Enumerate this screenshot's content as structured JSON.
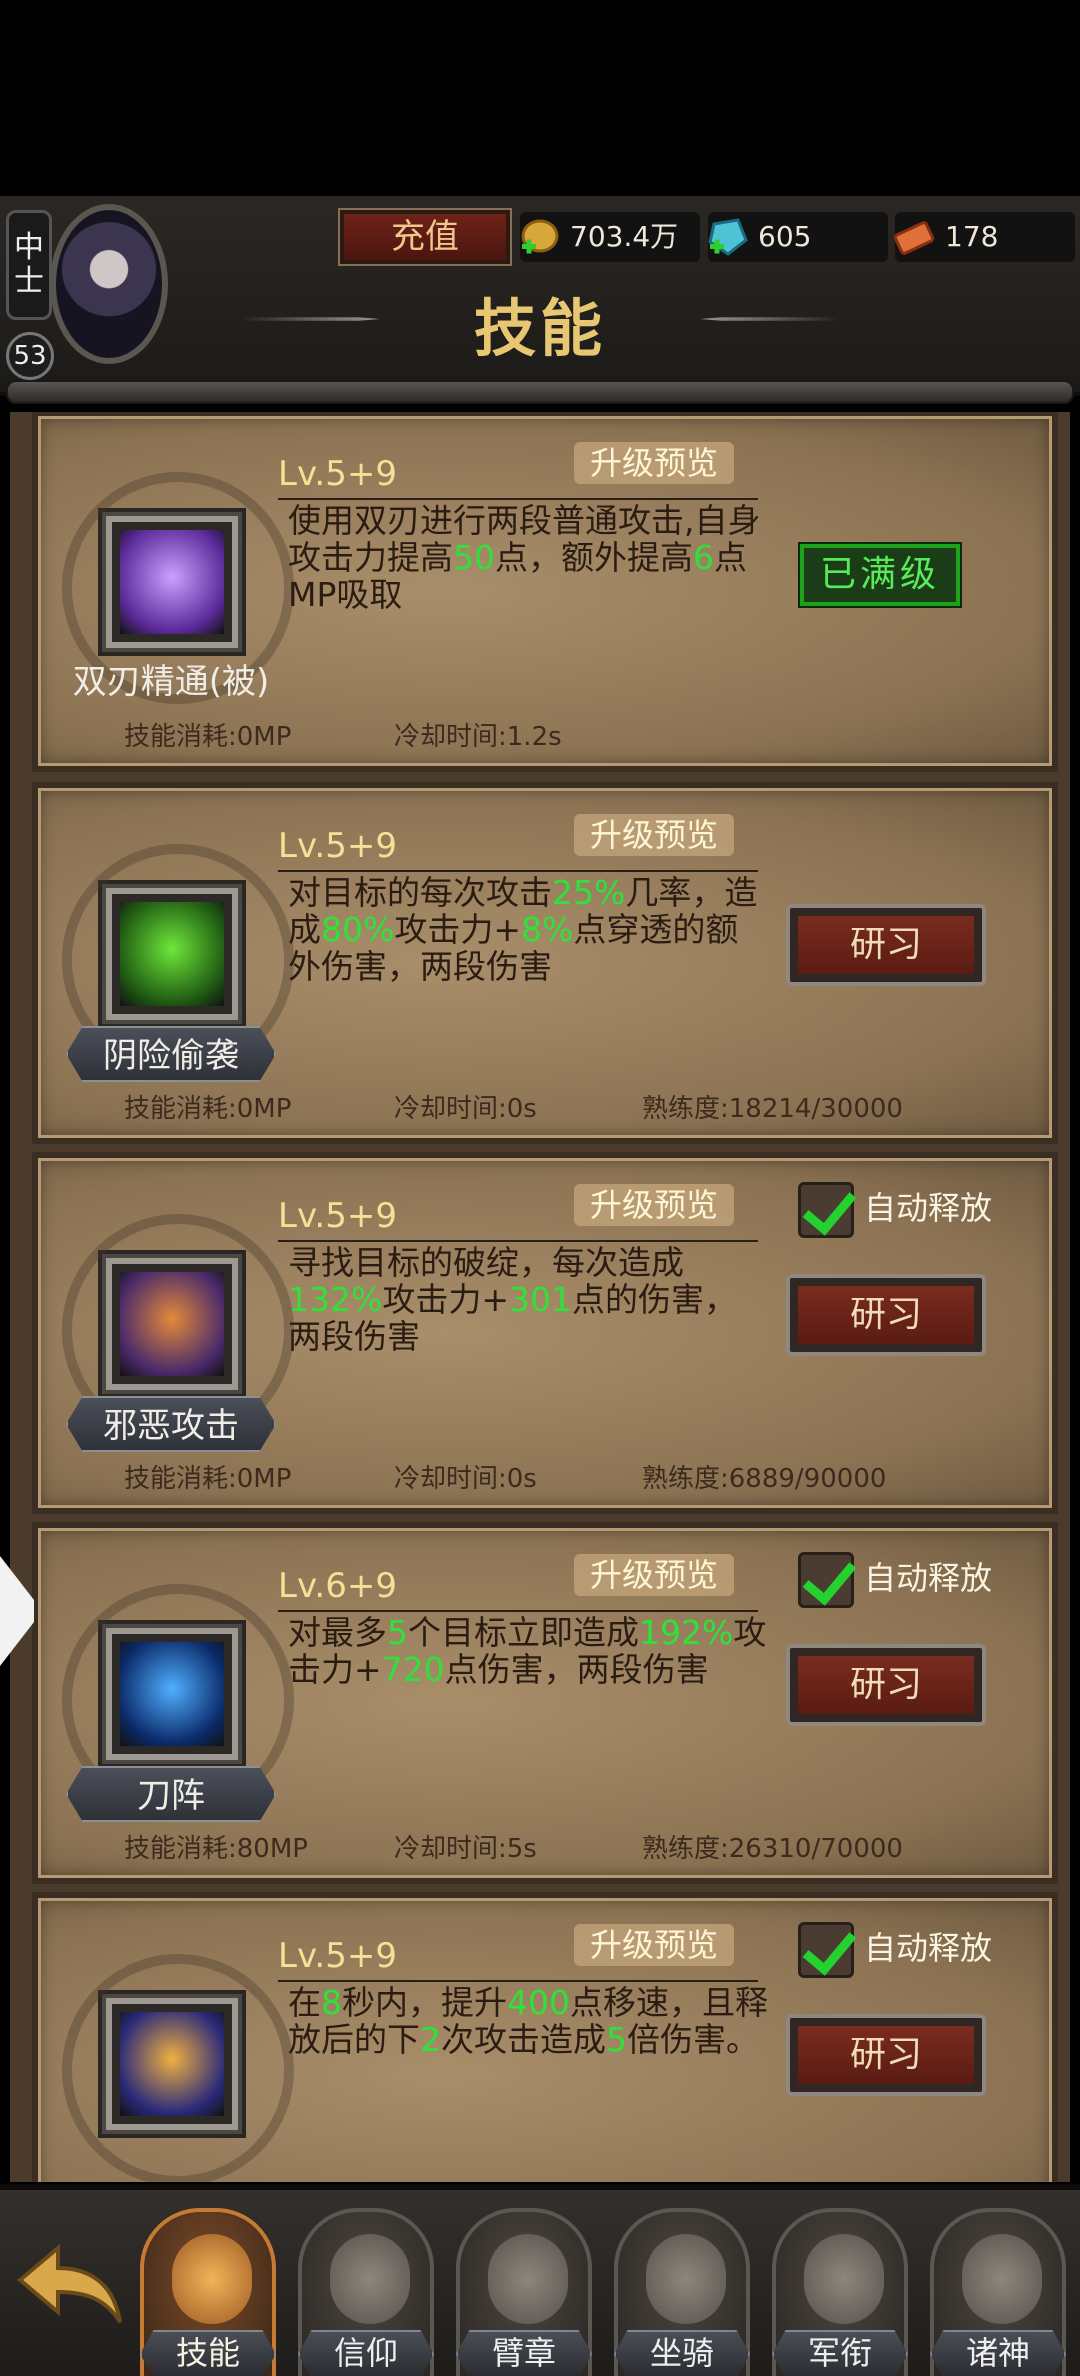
{
  "header": {
    "rank": "中士",
    "level": "53",
    "recharge_label": "充值",
    "gold": "703.4万",
    "gems": "605",
    "tickets": "178",
    "title": "技能"
  },
  "skills": [
    {
      "level": "Lv.5+9",
      "preview_label": "升级预览",
      "name": "双刃精通(被)",
      "desc": [
        {
          "t": "使用双刃进行两段普通攻击,自身攻击力提高"
        },
        {
          "t": "50",
          "hl": true
        },
        {
          "t": "点，额外提高"
        },
        {
          "t": "6",
          "hl": true
        },
        {
          "t": "点MP吸取"
        }
      ],
      "cost": "技能消耗:0MP",
      "cooldown": "冷却时间:1.2s",
      "proficiency": "",
      "action": "maxed",
      "action_label": "已满级"
    },
    {
      "level": "Lv.5+9",
      "preview_label": "升级预览",
      "name": "阴险偷袭",
      "desc": [
        {
          "t": "对目标的每次攻击"
        },
        {
          "t": "25%",
          "hl": true
        },
        {
          "t": "几率，造成"
        },
        {
          "t": "80%",
          "hl": true
        },
        {
          "t": "攻击力+"
        },
        {
          "t": "8%",
          "hl": true
        },
        {
          "t": "点穿透的额外伤害，两段伤害"
        }
      ],
      "cost": "技能消耗:0MP",
      "cooldown": "冷却时间:0s",
      "proficiency": "熟练度:18214/30000",
      "action": "study",
      "action_label": "研习"
    },
    {
      "level": "Lv.5+9",
      "preview_label": "升级预览",
      "name": "邪恶攻击",
      "auto_label": "自动释放",
      "desc": [
        {
          "t": "寻找目标的破绽，每次造成"
        },
        {
          "t": "132%",
          "hl": true
        },
        {
          "t": "攻击力+"
        },
        {
          "t": "301",
          "hl": true
        },
        {
          "t": "点的伤害，两段伤害"
        }
      ],
      "cost": "技能消耗:0MP",
      "cooldown": "冷却时间:0s",
      "proficiency": "熟练度:6889/90000",
      "action": "study",
      "action_label": "研习"
    },
    {
      "level": "Lv.6+9",
      "preview_label": "升级预览",
      "name": "刀阵",
      "auto_label": "自动释放",
      "desc": [
        {
          "t": "对最多"
        },
        {
          "t": "5",
          "hl": true
        },
        {
          "t": "个目标立即造成"
        },
        {
          "t": "192%",
          "hl": true
        },
        {
          "t": "攻击力+"
        },
        {
          "t": "720",
          "hl": true
        },
        {
          "t": "点伤害，两段伤害"
        }
      ],
      "cost": "技能消耗:80MP",
      "cooldown": "冷却时间:5s",
      "proficiency": "熟练度:26310/70000",
      "action": "study",
      "action_label": "研习"
    },
    {
      "level": "Lv.5+9",
      "preview_label": "升级预览",
      "name": "",
      "auto_label": "自动释放",
      "desc": [
        {
          "t": "在"
        },
        {
          "t": "8",
          "hl": true
        },
        {
          "t": "秒内，提升"
        },
        {
          "t": "400",
          "hl": true
        },
        {
          "t": "点移速，且释放后的下"
        },
        {
          "t": "2",
          "hl": true
        },
        {
          "t": "次攻击造成"
        },
        {
          "t": "5",
          "hl": true
        },
        {
          "t": "倍伤害。"
        }
      ],
      "cost": "",
      "cooldown": "",
      "proficiency": "",
      "action": "study",
      "action_label": "研习"
    }
  ],
  "nav": [
    {
      "label": "技能",
      "icon": "skill-emblem-icon",
      "active": true
    },
    {
      "label": "信仰",
      "icon": "faith-emblem-icon",
      "active": false
    },
    {
      "label": "臂章",
      "icon": "armband-emblem-icon",
      "active": false
    },
    {
      "label": "坐骑",
      "icon": "mount-emblem-icon",
      "active": false
    },
    {
      "label": "军衔",
      "icon": "military-rank-emblem-icon",
      "active": false
    },
    {
      "label": "诸神",
      "icon": "gods-emblem-icon",
      "active": false
    }
  ],
  "colors": {
    "highlight": "#2fe23a",
    "title_gold": "#e8c772",
    "card_bg": "#8b7252",
    "study_button": "#6e2318",
    "maxed_green": "#1ca21c"
  }
}
